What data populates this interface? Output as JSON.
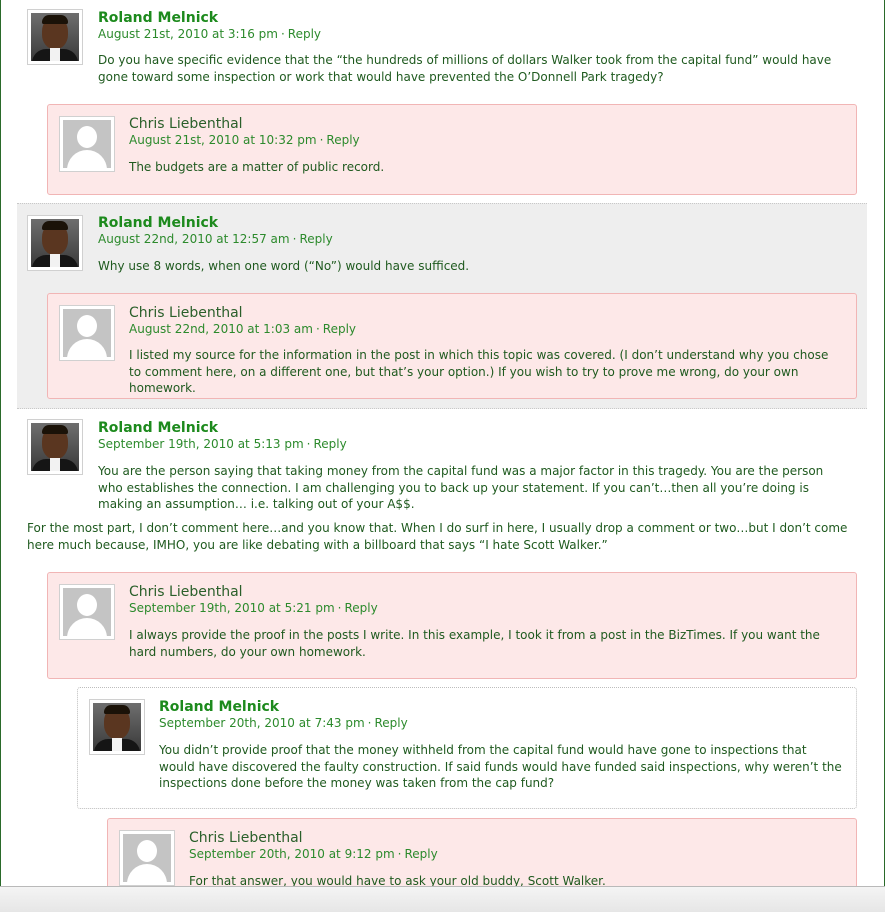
{
  "reply_label": "Reply",
  "comments": [
    {
      "author": "Roland Melnick",
      "date": "August 21st, 2010 at 3:16 pm",
      "paragraphs": [
        "Do you have specific evidence that the “the hundreds of millions of dollars Walker took from the capital fund” would have gone toward some inspection or work that would have prevented the O’Donnell Park tragedy?"
      ]
    },
    {
      "author": "Chris Liebenthal",
      "date": "August 21st, 2010 at 10:32 pm",
      "paragraphs": [
        "The budgets are a matter of public record."
      ]
    },
    {
      "author": "Roland Melnick",
      "date": "August 22nd, 2010 at 12:57 am",
      "paragraphs": [
        "Why use 8 words, when one word (“No”) would have sufficed."
      ]
    },
    {
      "author": "Chris Liebenthal",
      "date": "August 22nd, 2010 at 1:03 am",
      "paragraphs": [
        "I listed my source for the information in the post in which this topic was covered. (I don’t understand why you chose to comment here, on a different one, but that’s your option.) If you wish to try to prove me wrong, do your own homework."
      ]
    },
    {
      "author": "Roland Melnick",
      "date": "September 19th, 2010 at 5:13 pm",
      "paragraphs": [
        "You are the person saying that taking money from the capital fund was a major factor in this tragedy. You are the person who establishes the connection. I am challenging you to back up your statement. If you can’t…then all you’re doing is making an assumption… i.e. talking out of your A$$.",
        "For the most part, I don’t comment here…and you know that. When I do surf in here, I usually drop a comment or two…but I don’t come here much because, IMHO, you are like debating with a billboard that says “I hate Scott Walker.”"
      ]
    },
    {
      "author": "Chris Liebenthal",
      "date": "September 19th, 2010 at 5:21 pm",
      "paragraphs": [
        "I always provide the proof in the posts I write. In this example, I took it from a post in the BizTimes. If you want the hard numbers, do your own homework."
      ]
    },
    {
      "author": "Roland Melnick",
      "date": "September 20th, 2010 at 7:43 pm",
      "paragraphs": [
        "You didn’t provide proof that the money withheld from the capital fund would have gone to inspections that would have discovered the faulty construction. If said funds would have funded said inspections, why weren’t the inspections done before the money was taken from the cap fund?"
      ]
    },
    {
      "author": "Chris Liebenthal",
      "date": "September 20th, 2010 at 9:12 pm",
      "paragraphs": [
        "For that answer, you would have to ask your old buddy, Scott Walker."
      ]
    }
  ]
}
